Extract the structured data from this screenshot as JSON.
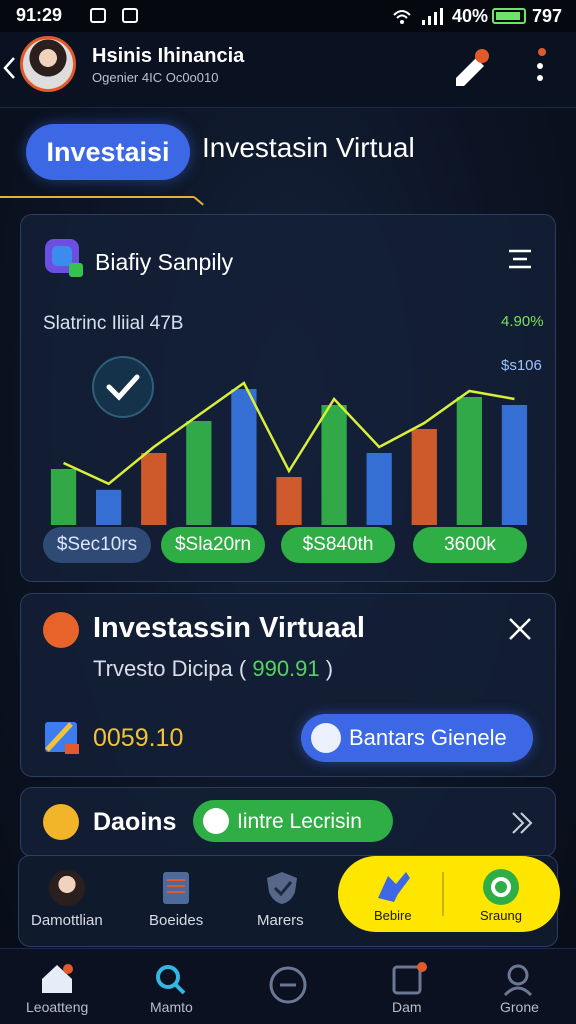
{
  "status_bar": {
    "time": "91:29",
    "battery_text": "40%",
    "extra": "797"
  },
  "header": {
    "name": "Hsinis Ihinancia",
    "subtitle": "Ogenier 4IC Oc0o010"
  },
  "tabs": {
    "active_label": "Investaisi",
    "title": "Investasin Virtual"
  },
  "chart_card": {
    "title": "Biafiy Sanpily",
    "subtitle": "Slatrinc Iliial 47B",
    "label_pct": "4.90%",
    "label_val": "$s106",
    "pills": [
      "$Sec10rs",
      "$Sla20rn",
      "$S840th",
      "3600k"
    ]
  },
  "chart_data": {
    "type": "bar",
    "series": [
      {
        "values": [
          3.5,
          2.2,
          4.5,
          6.5,
          8.5,
          3.0,
          7.5,
          4.5,
          6.0,
          8.0,
          7.5
        ]
      }
    ],
    "colors": {
      "up": "#37c24b",
      "down": "#f0652a",
      "blue": "#3c7ef0",
      "line": "#d9f03a"
    }
  },
  "investment_card": {
    "title": "Investassin Virtuaal",
    "text_prefix": "Trvesto Dicipa (",
    "highlight": "990.91",
    "text_suffix": ")",
    "amount": "0059.10",
    "button_label": "Bantars Gienele"
  },
  "daoins_card": {
    "title": "Daoins",
    "badge": "Iintre Lecrisin"
  },
  "action_bar": {
    "items": [
      "Damottlian",
      "Boeides",
      "Marers",
      "Bebire",
      "Sraung"
    ]
  },
  "bottom_nav": {
    "items": [
      "Leoatteng",
      "Mamto",
      "Dam",
      "Grone"
    ]
  },
  "colors": {
    "accent_blue": "#3c68e6",
    "green": "#2fae45",
    "yellow": "#ffe600",
    "gold": "#e0b432"
  }
}
